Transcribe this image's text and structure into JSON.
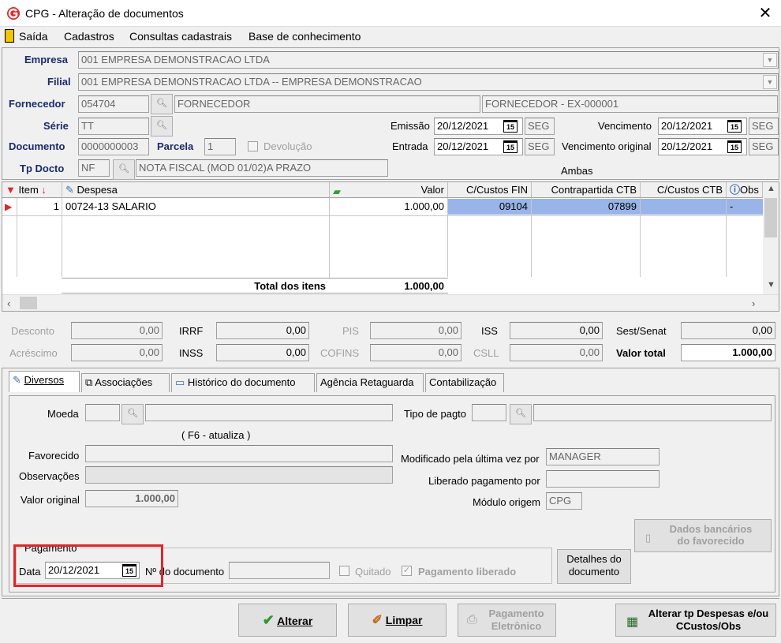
{
  "window": {
    "title": "CPG - Alteração de documentos",
    "close": "✕"
  },
  "menu": [
    "Saída",
    "Cadastros",
    "Consultas cadastrais",
    "Base de conhecimento"
  ],
  "header": {
    "empresa_label": "Empresa",
    "empresa_value": "001 EMPRESA DEMONSTRACAO LTDA",
    "filial_label": "Filial",
    "filial_value": "001 EMPRESA DEMONSTRACAO LTDA -- EMPRESA DEMONSTRACAO",
    "fornecedor_label": "Fornecedor",
    "fornecedor_code": "054704",
    "fornecedor_name": "FORNECEDOR",
    "fornecedor_ext": "FORNECEDOR - EX-000001",
    "serie_label": "Série",
    "serie_value": "TT",
    "emissao_label": "Emissão",
    "emissao_value": "20/12/2021",
    "emissao_dow": "SEG",
    "vencimento_label": "Vencimento",
    "vencimento_value": "20/12/2021",
    "vencimento_dow": "SEG",
    "documento_label": "Documento",
    "documento_value": "0000000003",
    "parcela_label": "Parcela",
    "parcela_value": "1",
    "devolucao_label": "Devolução",
    "entrada_label": "Entrada",
    "entrada_value": "20/12/2021",
    "entrada_dow": "SEG",
    "venc_orig_label": "Vencimento original",
    "venc_orig_value": "20/12/2021",
    "venc_orig_dow": "SEG",
    "tpdocto_label": "Tp Docto",
    "tpdocto_code": "NF",
    "tpdocto_desc": "NOTA FISCAL (MOD 01/02)A PRAZO",
    "ambas": "Ambas",
    "cal_label": "15"
  },
  "grid": {
    "columns": [
      "Item",
      "Despesa",
      "Valor",
      "C/Custos FIN",
      "Contrapartida CTB",
      "C/Custos CTB",
      "Obs"
    ],
    "rows": [
      {
        "item": "1",
        "despesa": "00724-13 SALARIO",
        "valor": "1.000,00",
        "ccfin": "09104",
        "contrapartida": "07899",
        "ccctb": "",
        "obs": "-"
      }
    ],
    "total_label": "Total dos itens",
    "total_value": "1.000,00"
  },
  "totals": {
    "desconto_label": "Desconto",
    "desconto": "0,00",
    "irrf_label": "IRRF",
    "irrf": "0,00",
    "pis_label": "PIS",
    "pis": "0,00",
    "iss_label": "ISS",
    "iss": "0,00",
    "sest_label": "Sest/Senat",
    "sest": "0,00",
    "acrescimo_label": "Acréscimo",
    "acrescimo": "0,00",
    "inss_label": "INSS",
    "inss": "0,00",
    "cofins_label": "COFINS",
    "cofins": "0,00",
    "csll_label": "CSLL",
    "csll": "0,00",
    "valortotal_label": "Valor total",
    "valortotal": "1.000,00"
  },
  "tabs": [
    "Diversos",
    "Associações",
    "Histórico do documento",
    "Agência Retaguarda",
    "Contabilização"
  ],
  "diversos": {
    "moeda_label": "Moeda",
    "tipopagto_label": "Tipo de pagto",
    "f6_label": "( F6 - atualiza )",
    "favorecido_label": "Favorecido",
    "modificado_label": "Modificado pela última vez por",
    "modificado_value": "MANAGER",
    "observacoes_label": "Observações",
    "liberado_label": "Liberado pagamento por",
    "valororiginal_label": "Valor original",
    "valororiginal_value": "1.000,00",
    "modulo_label": "Módulo origem",
    "modulo_value": "CPG",
    "dados_bancarios": "Dados bancários\ndo favorecido",
    "pagamento_group": "Pagamento",
    "data_label": "Data",
    "data_value": "20/12/2021",
    "ndoc_label": "Nº do documento",
    "quitado_label": "Quitado",
    "pagliberado_label": "Pagamento liberado",
    "detalhes_label": "Detalhes do documento"
  },
  "buttons": {
    "alterar": "Alterar",
    "limpar": "Limpar",
    "pagamento": "Pagamento Eletrônico",
    "alterar_tp": "Alterar tp Despesas e/ou CCustos/Obs"
  }
}
